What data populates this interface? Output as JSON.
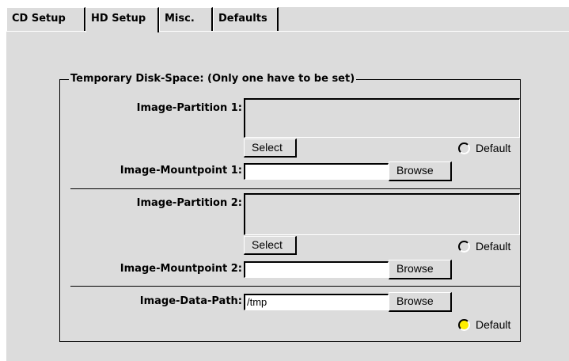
{
  "tabs": [
    {
      "label": "CD Setup"
    },
    {
      "label": "HD Setup"
    },
    {
      "label": "Misc."
    },
    {
      "label": "Defaults"
    }
  ],
  "active_tab": "HD Setup",
  "group": {
    "title": "Temporary Disk-Space: (Only one have to be set)"
  },
  "partition1": {
    "label": "Image-Partition 1:",
    "select_label": "Select",
    "default_label": "Default",
    "default_selected": false
  },
  "mountpoint1": {
    "label": "Image-Mountpoint 1:",
    "value": "",
    "browse_label": "Browse"
  },
  "partition2": {
    "label": "Image-Partition 2:",
    "select_label": "Select",
    "default_label": "Default",
    "default_selected": false
  },
  "mountpoint2": {
    "label": "Image-Mountpoint 2:",
    "value": "",
    "browse_label": "Browse"
  },
  "datapath": {
    "label": "Image-Data-Path:",
    "value": "/tmp",
    "browse_label": "Browse",
    "default_label": "Default",
    "default_selected": true
  },
  "colors": {
    "background": "#dcdcdc",
    "radio_selected": "#ffee00"
  }
}
